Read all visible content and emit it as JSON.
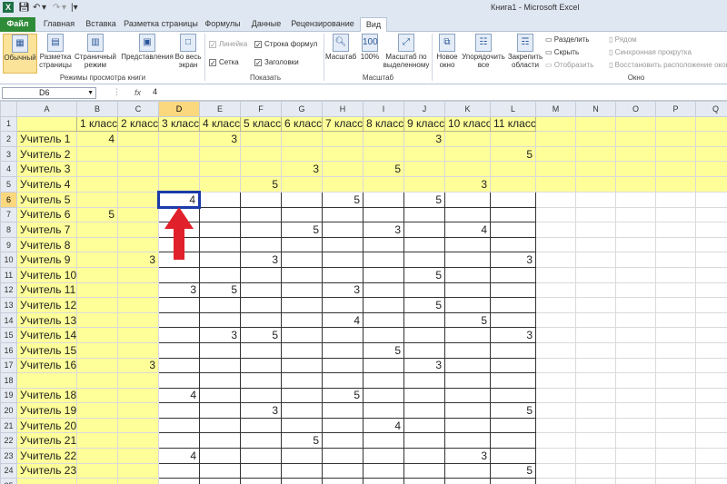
{
  "titlebar": {
    "title": "Книга1 - Microsoft Excel"
  },
  "tabs": [
    {
      "label": "Файл"
    },
    {
      "label": "Главная"
    },
    {
      "label": "Вставка"
    },
    {
      "label": "Разметка страницы"
    },
    {
      "label": "Формулы"
    },
    {
      "label": "Данные"
    },
    {
      "label": "Рецензирование"
    },
    {
      "label": "Вид"
    }
  ],
  "ribbon": {
    "views": {
      "normal": "Обычный",
      "page_layout": "Разметка страницы",
      "page_break": "Страничный режим",
      "custom": "Представления",
      "full_screen": "Во весь экран",
      "group": "Режимы просмотра книги"
    },
    "show": {
      "ruler": "Линейка",
      "formula_bar": "Строка формул",
      "gridlines": "Сетка",
      "headings": "Заголовки",
      "group": "Показать"
    },
    "zoom": {
      "zoom": "Масштаб",
      "zoom100": "100%",
      "zoom_sel": "Масштаб по выделенному",
      "group": "Масштаб"
    },
    "window": {
      "new": "Новое окно",
      "arrange": "Упорядочить все",
      "freeze": "Закрепить области",
      "split": "Разделить",
      "hide": "Скрыть",
      "unhide": "Отобразить",
      "side": "Рядом",
      "sync": "Синхронная прокрутка",
      "reset": "Восстановить расположение окон",
      "group": "Окно"
    }
  },
  "formula": {
    "cell": "D6",
    "fx": "fx",
    "value": "4"
  },
  "columns": [
    "A",
    "B",
    "C",
    "D",
    "E",
    "F",
    "G",
    "H",
    "I",
    "J",
    "K",
    "L",
    "M",
    "N",
    "O",
    "P",
    "Q"
  ],
  "rows": [
    {
      "n": "1",
      "cells": [
        "",
        "1 класс",
        "2 класс",
        "3 класс",
        "4 класс",
        "5 класс",
        "6 класс",
        "7 класс",
        "8 класс",
        "9 класс",
        "10 класс",
        "11 класс"
      ]
    },
    {
      "n": "2",
      "cells": [
        "Учитель 1",
        "4",
        "",
        "",
        "3",
        "",
        "",
        "",
        "",
        "3",
        "",
        ""
      ]
    },
    {
      "n": "3",
      "cells": [
        "Учитель 2",
        "",
        "",
        "",
        "",
        "",
        "",
        "",
        "",
        "",
        "",
        "5"
      ]
    },
    {
      "n": "4",
      "cells": [
        "Учитель 3",
        "",
        "",
        "",
        "",
        "",
        "3",
        "",
        "5",
        "",
        "",
        ""
      ]
    },
    {
      "n": "5",
      "cells": [
        "Учитель 4",
        "",
        "",
        "",
        "",
        "5",
        "",
        "",
        "",
        "",
        "3",
        ""
      ]
    },
    {
      "n": "6",
      "cells": [
        "Учитель 5",
        "",
        "",
        "4",
        "",
        "",
        "",
        "5",
        "",
        "5",
        "",
        ""
      ]
    },
    {
      "n": "7",
      "cells": [
        "Учитель 6",
        "5",
        "",
        "",
        "",
        "",
        "",
        "",
        "",
        "",
        "",
        ""
      ]
    },
    {
      "n": "8",
      "cells": [
        "Учитель 7",
        "",
        "",
        "",
        "",
        "",
        "5",
        "",
        "3",
        "",
        "4",
        ""
      ]
    },
    {
      "n": "9",
      "cells": [
        "Учитель 8",
        "",
        "",
        "",
        "",
        "",
        "",
        "",
        "",
        "",
        "",
        ""
      ]
    },
    {
      "n": "10",
      "cells": [
        "Учитель 9",
        "",
        "3",
        "",
        "",
        "3",
        "",
        "",
        "",
        "",
        "",
        "3"
      ]
    },
    {
      "n": "11",
      "cells": [
        "Учитель 10",
        "",
        "",
        "",
        "",
        "",
        "",
        "",
        "",
        "5",
        "",
        ""
      ]
    },
    {
      "n": "12",
      "cells": [
        "Учитель 11",
        "",
        "",
        "3",
        "5",
        "",
        "",
        "3",
        "",
        "",
        "",
        ""
      ]
    },
    {
      "n": "13",
      "cells": [
        "Учитель 12",
        "",
        "",
        "",
        "",
        "",
        "",
        "",
        "",
        "5",
        "",
        ""
      ]
    },
    {
      "n": "14",
      "cells": [
        "Учитель 13",
        "",
        "",
        "",
        "",
        "",
        "",
        "4",
        "",
        "",
        "5",
        ""
      ]
    },
    {
      "n": "15",
      "cells": [
        "Учитель 14",
        "",
        "",
        "",
        "3",
        "5",
        "",
        "",
        "",
        "",
        "",
        "3"
      ]
    },
    {
      "n": "16",
      "cells": [
        "Учитель 15",
        "",
        "",
        "",
        "",
        "",
        "",
        "",
        "5",
        "",
        "",
        ""
      ]
    },
    {
      "n": "17",
      "cells": [
        "Учитель 16",
        "",
        "3",
        "",
        "",
        "",
        "",
        "",
        "",
        "3",
        "",
        ""
      ]
    },
    {
      "n": "18",
      "cells": [
        "",
        "",
        "",
        "",
        "",
        "",
        "",
        "",
        "",
        "",
        "",
        ""
      ]
    },
    {
      "n": "19",
      "cells": [
        "Учитель 18",
        "",
        "",
        "4",
        "",
        "",
        "",
        "5",
        "",
        "",
        "",
        ""
      ]
    },
    {
      "n": "20",
      "cells": [
        "Учитель 19",
        "",
        "",
        "",
        "",
        "3",
        "",
        "",
        "",
        "",
        "",
        "5"
      ]
    },
    {
      "n": "21",
      "cells": [
        "Учитель 20",
        "",
        "",
        "",
        "",
        "",
        "",
        "",
        "4",
        "",
        "",
        ""
      ]
    },
    {
      "n": "22",
      "cells": [
        "Учитель 21",
        "",
        "",
        "",
        "",
        "",
        "5",
        "",
        "",
        "",
        "",
        ""
      ]
    },
    {
      "n": "23",
      "cells": [
        "Учитель 22",
        "",
        "",
        "4",
        "",
        "",
        "",
        "",
        "",
        "",
        "3",
        ""
      ]
    },
    {
      "n": "24",
      "cells": [
        "Учитель 23",
        "",
        "",
        "",
        "",
        "",
        "",
        "",
        "",
        "",
        "",
        "5"
      ]
    },
    {
      "n": "25",
      "cells": [
        "",
        "",
        "",
        "",
        "",
        "",
        "",
        "",
        "",
        "",
        "",
        ""
      ]
    }
  ],
  "selection": {
    "row": "6",
    "col": "D"
  },
  "colors": {
    "highlight": "#ffff99",
    "selection_border": "#1c3aa9",
    "arrow": "#e0202a"
  }
}
